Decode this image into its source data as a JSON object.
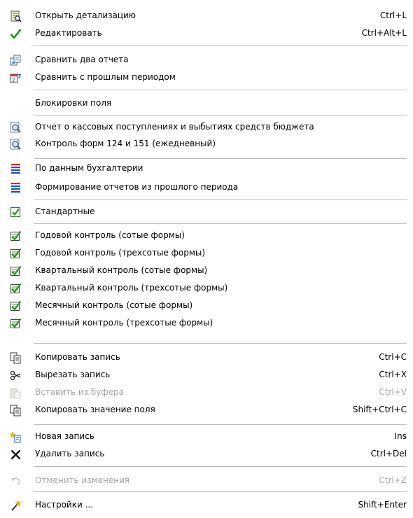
{
  "menu": {
    "groups": [
      {
        "items": [
          {
            "label": "Открыть детализацию",
            "shortcut": "Ctrl+L",
            "icon": "open-detail-icon",
            "disabled": false
          },
          {
            "label": "Редактировать",
            "shortcut": "Ctrl+Alt+L",
            "icon": "checkmark-icon",
            "disabled": false
          }
        ]
      },
      {
        "items": [
          {
            "label": "Сравнить два отчета",
            "shortcut": "",
            "icon": "compare-reports-icon",
            "disabled": false
          },
          {
            "label": "Сравнить с прошлым периодом",
            "shortcut": "",
            "icon": "compare-period-icon",
            "disabled": false
          }
        ]
      },
      {
        "items": [
          {
            "label": "Блокировки поля",
            "shortcut": "",
            "icon": "",
            "disabled": false
          }
        ]
      },
      {
        "items": [
          {
            "label": "Отчет о кассовых поступлениях и выбытиях средств бюджета",
            "shortcut": "",
            "icon": "magnifier-report-icon",
            "disabled": false
          },
          {
            "label": "Контроль форм 124 и 151 (ежедневный)",
            "shortcut": "",
            "icon": "magnifier-report-icon",
            "disabled": false
          }
        ]
      },
      {
        "items": [
          {
            "label": "По данным бухгалтерии",
            "shortcut": "",
            "icon": "list-lines-icon",
            "disabled": false
          },
          {
            "label": "Формирование отчетов из прошлого периода",
            "shortcut": "",
            "icon": "list-lines-icon",
            "disabled": false
          }
        ]
      },
      {
        "items": [
          {
            "label": "Стандартные",
            "shortcut": "",
            "icon": "checkbox-checked-icon",
            "disabled": false
          }
        ]
      },
      {
        "items": [
          {
            "label": "Годовой контроль (сотые формы)",
            "shortcut": "",
            "icon": "control-form-icon",
            "disabled": false
          },
          {
            "label": "Годовой контроль (трехсотые формы)",
            "shortcut": "",
            "icon": "control-form-icon",
            "disabled": false
          },
          {
            "label": "Квартальный контроль (сотые формы)",
            "shortcut": "",
            "icon": "control-form-icon",
            "disabled": false
          },
          {
            "label": "Квартальный контроль (трехсотые формы)",
            "shortcut": "",
            "icon": "control-form-icon",
            "disabled": false
          },
          {
            "label": "Месячный контроль (сотые формы)",
            "shortcut": "",
            "icon": "control-form-icon",
            "disabled": false
          },
          {
            "label": "Месячный контроль (трехсотые формы)",
            "shortcut": "",
            "icon": "control-form-icon",
            "disabled": false
          }
        ]
      },
      {
        "items": [
          {
            "label": "Копировать запись",
            "shortcut": "Ctrl+C",
            "icon": "copy-icon",
            "disabled": false
          },
          {
            "label": "Вырезать запись",
            "shortcut": "Ctrl+X",
            "icon": "scissors-icon",
            "disabled": false
          },
          {
            "label": "Вставить из буфера",
            "shortcut": "Ctrl+V",
            "icon": "paste-icon",
            "disabled": true
          },
          {
            "label": "Копировать значение поля",
            "shortcut": "Shift+Ctrl+C",
            "icon": "copy-icon",
            "disabled": false
          }
        ]
      },
      {
        "items": [
          {
            "label": "Новая запись",
            "shortcut": "Ins",
            "icon": "new-record-icon",
            "disabled": false
          },
          {
            "label": "Удалить запись",
            "shortcut": "Ctrl+Del",
            "icon": "delete-x-icon",
            "disabled": false
          }
        ]
      },
      {
        "items": [
          {
            "label": "Отменить изменения",
            "shortcut": "Ctrl+Z",
            "icon": "undo-icon",
            "disabled": true
          }
        ]
      },
      {
        "items": [
          {
            "label": "Настройки ...",
            "shortcut": "Shift+Enter",
            "icon": "settings-wand-icon",
            "disabled": false
          }
        ]
      }
    ]
  }
}
